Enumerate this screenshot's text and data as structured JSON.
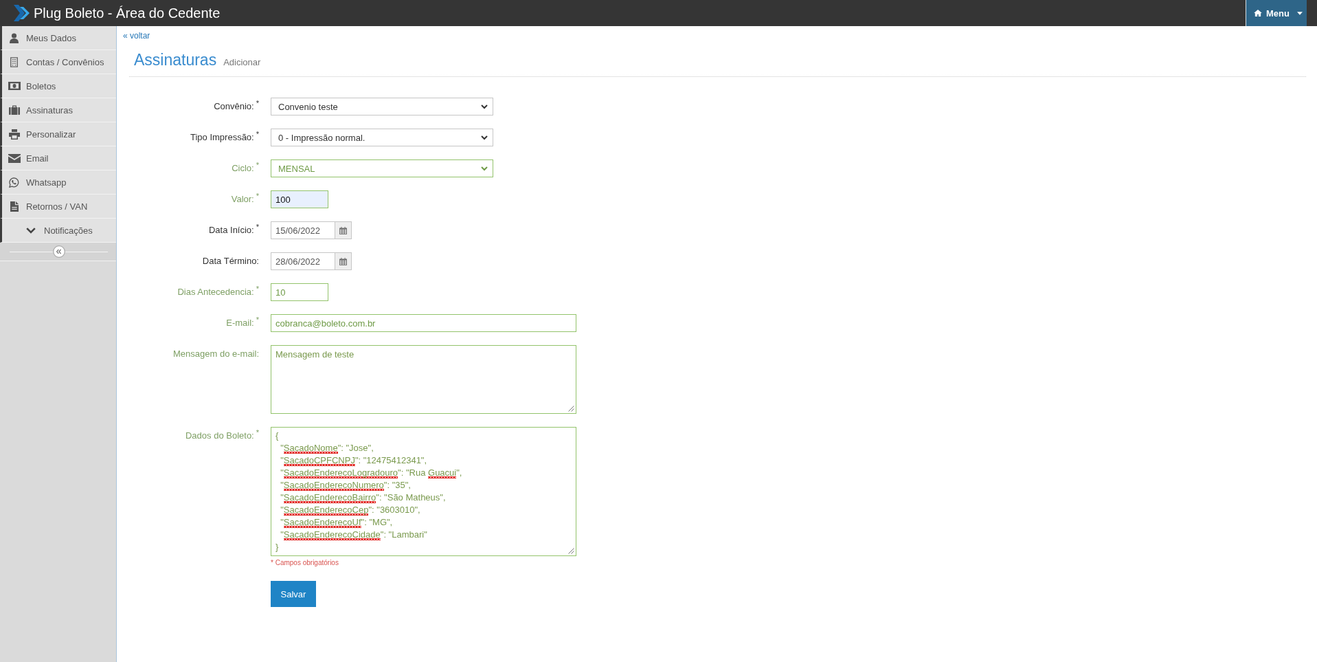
{
  "header": {
    "title": "Plug Boleto - Área do Cedente",
    "menu_button": "Menu"
  },
  "sidebar": {
    "items": [
      {
        "label": "Meus Dados",
        "kind": "link",
        "selected": false
      },
      {
        "label": "Contas / Convênios",
        "kind": "link",
        "selected": false
      },
      {
        "label": "Boletos",
        "kind": "link",
        "selected": false
      },
      {
        "label": "Assinaturas",
        "kind": "link",
        "selected": false
      },
      {
        "label": "Personalizar",
        "kind": "link",
        "selected": false
      },
      {
        "label": "Email",
        "kind": "link",
        "selected": false
      },
      {
        "label": "Whatsapp",
        "kind": "link",
        "selected": false
      },
      {
        "label": "Retornos / VAN",
        "kind": "link",
        "selected": false
      },
      {
        "label": "Notificações",
        "kind": "submenu",
        "selected": false
      }
    ]
  },
  "page": {
    "back_link": "« voltar",
    "title": "Assinaturas",
    "subtitle": "Adicionar"
  },
  "form": {
    "fields": [
      {
        "kind": "select",
        "label": "Convênio:",
        "required_mark": "*",
        "value": "Convenio teste",
        "valid": false,
        "autofilled": false
      },
      {
        "kind": "select",
        "label": "Tipo Impressão:",
        "required_mark": "*",
        "value": "0 - Impressão normal.",
        "valid": false,
        "autofilled": false
      },
      {
        "kind": "select",
        "label": "Ciclo:",
        "required_mark": "*",
        "value": "MENSAL",
        "valid": true,
        "autofilled": false
      },
      {
        "kind": "short",
        "label": "Valor:",
        "required_mark": "*",
        "value": "100",
        "valid": true,
        "autofilled": true
      },
      {
        "kind": "date",
        "label": "Data Início:",
        "required_mark": "*",
        "value": "15/06/2022",
        "valid": false,
        "autofilled": false
      },
      {
        "kind": "date",
        "label": "Data Término:",
        "value": "28/06/2022",
        "valid": false,
        "autofilled": false
      },
      {
        "kind": "short",
        "label": "Dias Antecedencia:",
        "required_mark": "*",
        "value": "10",
        "valid": true,
        "autofilled": false
      },
      {
        "kind": "text",
        "label": "E-mail:",
        "required_mark": "*",
        "value": "cobranca@boleto.com.br",
        "valid": true,
        "autofilled": false
      },
      {
        "kind": "textarea",
        "label": "Mensagem do e-mail:",
        "value": "Mensagem de teste",
        "valid": true,
        "autofilled": false
      },
      {
        "kind": "code",
        "label": "Dados do Boleto:",
        "required_mark": "*",
        "valid": true,
        "autofilled": false,
        "lines": [
          {
            "segments": [
              {
                "text": "{",
                "misspelled": false
              }
            ]
          },
          {
            "segments": [
              {
                "text": "  \"",
                "misspelled": false
              },
              {
                "text": "SacadoNome",
                "misspelled": true
              },
              {
                "text": "\": \"Jose\",",
                "misspelled": false
              }
            ]
          },
          {
            "segments": [
              {
                "text": "  \"",
                "misspelled": false
              },
              {
                "text": "SacadoCPFCNPJ",
                "misspelled": true
              },
              {
                "text": "\": \"12475412341\",",
                "misspelled": false
              }
            ]
          },
          {
            "segments": [
              {
                "text": "  \"",
                "misspelled": false
              },
              {
                "text": "SacadoEnderecoLogradouro",
                "misspelled": true
              },
              {
                "text": "\": \"Rua ",
                "misspelled": false
              },
              {
                "text": "Guacui",
                "misspelled": true
              },
              {
                "text": "\",",
                "misspelled": false
              }
            ]
          },
          {
            "segments": [
              {
                "text": "  \"",
                "misspelled": false
              },
              {
                "text": "SacadoEnderecoNumero",
                "misspelled": true
              },
              {
                "text": "\": \"35\",",
                "misspelled": false
              }
            ]
          },
          {
            "segments": [
              {
                "text": "  \"",
                "misspelled": false
              },
              {
                "text": "SacadoEnderecoBairro",
                "misspelled": true
              },
              {
                "text": "\": \"São Matheus\",",
                "misspelled": false
              }
            ]
          },
          {
            "segments": [
              {
                "text": "  \"",
                "misspelled": false
              },
              {
                "text": "SacadoEnderecoCep",
                "misspelled": true
              },
              {
                "text": "\": \"3603010\",",
                "misspelled": false
              }
            ]
          },
          {
            "segments": [
              {
                "text": "  \"",
                "misspelled": false
              },
              {
                "text": "SacadoEnderecoUf",
                "misspelled": true
              },
              {
                "text": "\": \"MG\",",
                "misspelled": false
              }
            ]
          },
          {
            "segments": [
              {
                "text": "  \"",
                "misspelled": false
              },
              {
                "text": "SacadoEnderecoCidade",
                "misspelled": true
              },
              {
                "text": "\": \"Lambari\"",
                "misspelled": false
              }
            ]
          },
          {
            "segments": [
              {
                "text": "}",
                "misspelled": false
              }
            ]
          }
        ]
      }
    ],
    "required_note": "* Campos obrigatórios",
    "submit_button": "Salvar"
  }
}
